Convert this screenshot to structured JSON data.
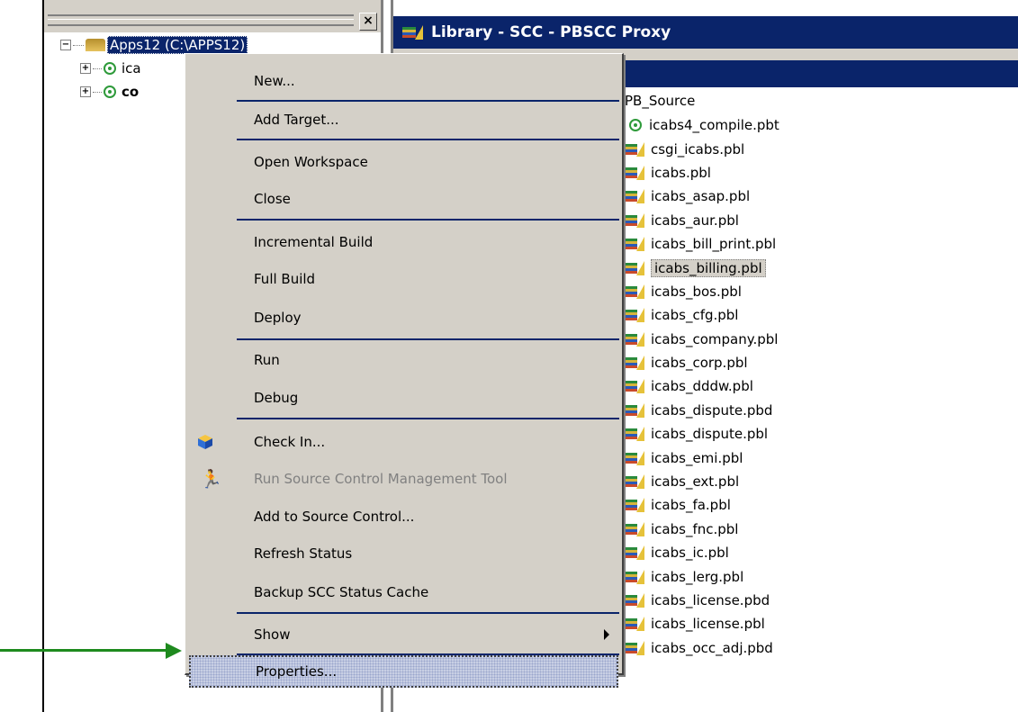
{
  "workspace_panel": {
    "root_label": "Apps12 (C:\\APPS12)",
    "children": [
      "ica",
      "co"
    ]
  },
  "library_panel": {
    "title": "Library  -  SCC - PBSCC Proxy",
    "folder": "PB_Source",
    "files": [
      {
        "name": "icabs4_compile.pbt",
        "icon": "target-icon"
      },
      {
        "name": "csgi_icabs.pbl",
        "icon": "library-icon"
      },
      {
        "name": "icabs.pbl",
        "icon": "library-icon"
      },
      {
        "name": "icabs_asap.pbl",
        "icon": "library-icon"
      },
      {
        "name": "icabs_aur.pbl",
        "icon": "library-icon"
      },
      {
        "name": "icabs_bill_print.pbl",
        "icon": "library-icon"
      },
      {
        "name": "icabs_billing.pbl",
        "icon": "library-icon",
        "selected": true
      },
      {
        "name": "icabs_bos.pbl",
        "icon": "library-icon"
      },
      {
        "name": "icabs_cfg.pbl",
        "icon": "library-icon"
      },
      {
        "name": "icabs_company.pbl",
        "icon": "library-icon"
      },
      {
        "name": "icabs_corp.pbl",
        "icon": "library-icon"
      },
      {
        "name": "icabs_dddw.pbl",
        "icon": "library-icon"
      },
      {
        "name": "icabs_dispute.pbd",
        "icon": "library-icon"
      },
      {
        "name": "icabs_dispute.pbl",
        "icon": "library-icon"
      },
      {
        "name": "icabs_emi.pbl",
        "icon": "library-icon"
      },
      {
        "name": "icabs_ext.pbl",
        "icon": "library-icon"
      },
      {
        "name": "icabs_fa.pbl",
        "icon": "library-icon"
      },
      {
        "name": "icabs_fnc.pbl",
        "icon": "library-icon"
      },
      {
        "name": "icabs_ic.pbl",
        "icon": "library-icon"
      },
      {
        "name": "icabs_lerg.pbl",
        "icon": "library-icon"
      },
      {
        "name": "icabs_license.pbd",
        "icon": "library-icon"
      },
      {
        "name": "icabs_license.pbl",
        "icon": "library-icon"
      },
      {
        "name": "icabs_occ_adj.pbd",
        "icon": "library-icon"
      }
    ]
  },
  "context_menu": {
    "new": "New...",
    "add_target": "Add Target...",
    "open_workspace": "Open Workspace",
    "close": "Close",
    "incremental_build": "Incremental Build",
    "full_build": "Full Build",
    "deploy": "Deploy",
    "run": "Run",
    "debug": "Debug",
    "check_in": "Check In...",
    "run_scc_tool": "Run Source Control Management Tool",
    "add_to_source_control": "Add to Source Control...",
    "refresh_status": "Refresh Status",
    "backup_scc_cache": "Backup SCC Status Cache",
    "show": "Show",
    "properties": "Properties..."
  },
  "colors": {
    "title_bar": "#0a246a",
    "menu_bg": "#d4d0c8",
    "arrow": "#1e8a1e"
  }
}
